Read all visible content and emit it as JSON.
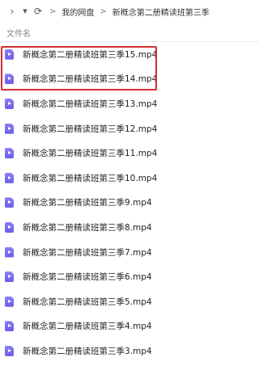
{
  "toolbar": {
    "breadcrumb_root": "我的网盘",
    "breadcrumb_sep": ">",
    "breadcrumb_current": "新概念第二册精读班第三季"
  },
  "list_header": {
    "column_name": "文件名"
  },
  "files": [
    {
      "name": "新概念第二册精读班第三季15.mp4"
    },
    {
      "name": "新概念第二册精读班第三季14.mp4"
    },
    {
      "name": "新概念第二册精读班第三季13.mp4"
    },
    {
      "name": "新概念第二册精读班第三季12.mp4"
    },
    {
      "name": "新概念第二册精读班第三季11.mp4"
    },
    {
      "name": "新概念第二册精读班第三季10.mp4"
    },
    {
      "name": "新概念第二册精读班第三季9.mp4"
    },
    {
      "name": "新概念第二册精读班第三季8.mp4"
    },
    {
      "name": "新概念第二册精读班第三季7.mp4"
    },
    {
      "name": "新概念第二册精读班第三季6.mp4"
    },
    {
      "name": "新概念第二册精读班第三季5.mp4"
    },
    {
      "name": "新概念第二册精读班第三季4.mp4"
    },
    {
      "name": "新概念第二册精读班第三季3.mp4"
    }
  ],
  "colors": {
    "file_icon": "#7b6cf0",
    "highlight_border": "#d32f2f"
  }
}
